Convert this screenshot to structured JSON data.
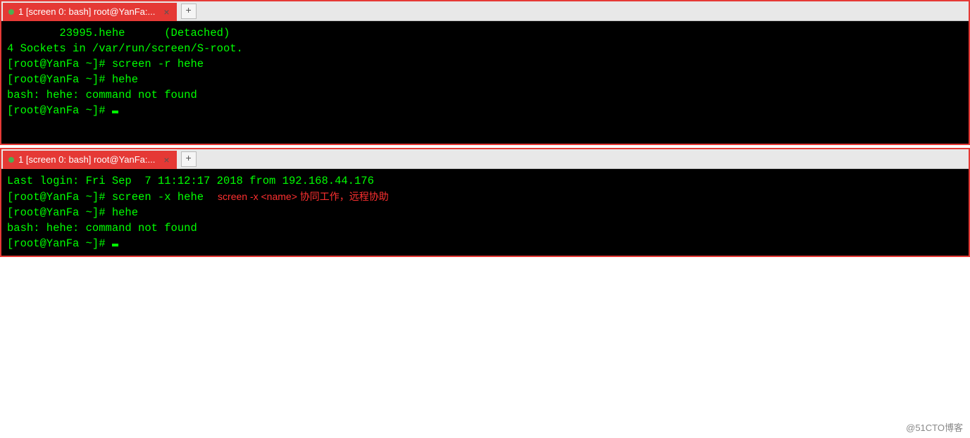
{
  "window1": {
    "tab": {
      "label": "1 [screen 0: bash] root@YanFa:...",
      "close": "×"
    },
    "newTab": "+",
    "lines": {
      "l1": "        23995.hehe      (Detached)",
      "l2": "4 Sockets in /var/run/screen/S-root.",
      "l3": "",
      "l4": "[root@YanFa ~]# screen -r hehe",
      "l5": "",
      "l6": "[root@YanFa ~]# hehe",
      "l7": "bash: hehe: command not found",
      "l8": "[root@YanFa ~]# "
    }
  },
  "window2": {
    "tab": {
      "label": "1 [screen 0: bash] root@YanFa:...",
      "close": "×"
    },
    "newTab": "+",
    "lines": {
      "l1": "Last login: Fri Sep  7 11:12:17 2018 from 192.168.44.176",
      "l2": "[root@YanFa ~]# screen -x hehe",
      "l2_annotation": "screen -x <name> 协同工作，远程协助",
      "l3": "",
      "l4": "[root@YanFa ~]# hehe",
      "l5": "bash: hehe: command not found",
      "l6": "[root@YanFa ~]# "
    }
  },
  "watermark": "@51CTO博客"
}
